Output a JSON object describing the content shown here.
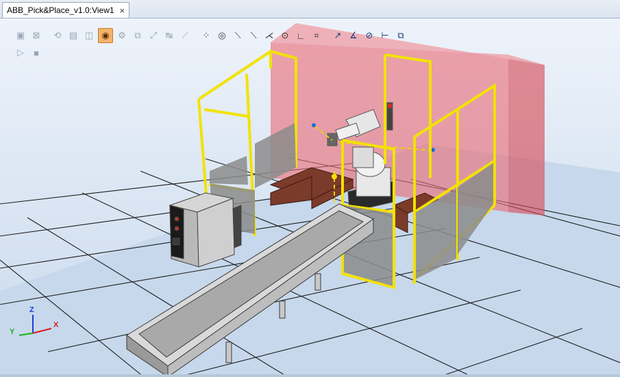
{
  "window": {
    "tab_title": "ABB_Pick&Place_v1.0:View1",
    "tab_close": "×"
  },
  "toolbar": {
    "row1_group1": [
      {
        "name": "view-all-icon",
        "glyph": "▣"
      },
      {
        "name": "view-center-icon",
        "glyph": "⊠"
      }
    ],
    "row1_group2": [
      {
        "name": "select-curve-icon",
        "glyph": "⟲"
      },
      {
        "name": "select-surface-icon",
        "glyph": "▤"
      },
      {
        "name": "select-body-icon",
        "glyph": "◫"
      },
      {
        "name": "select-part-icon",
        "glyph": "◉"
      },
      {
        "name": "select-mechanism-icon",
        "glyph": "⚙"
      },
      {
        "name": "select-group-icon",
        "glyph": "⧉"
      },
      {
        "name": "select-target-icon",
        "glyph": "⤢"
      },
      {
        "name": "select-path-icon",
        "glyph": "↹"
      },
      {
        "name": "select-frame-icon",
        "glyph": "⟋"
      }
    ],
    "row1_group3": [
      {
        "name": "snap-object-icon",
        "glyph": "⁘"
      },
      {
        "name": "snap-center-icon",
        "glyph": "◎"
      },
      {
        "name": "snap-mid-icon",
        "glyph": "⟍"
      },
      {
        "name": "snap-edge-icon",
        "glyph": "⟍"
      },
      {
        "name": "snap-corner-icon",
        "glyph": "⋌"
      },
      {
        "name": "snap-surface-icon",
        "glyph": "⊙"
      },
      {
        "name": "snap-local-icon",
        "glyph": "∟"
      },
      {
        "name": "snap-grid-icon",
        "glyph": "⌗"
      }
    ],
    "row1_group4": [
      {
        "name": "measure-distance-icon",
        "glyph": "↗"
      },
      {
        "name": "measure-angle-icon",
        "glyph": "∡"
      },
      {
        "name": "measure-diameter-icon",
        "glyph": "⊘"
      },
      {
        "name": "measure-minimum-icon",
        "glyph": "⊢"
      },
      {
        "name": "measure-points-icon",
        "glyph": "⧉"
      }
    ],
    "row2": [
      {
        "name": "simulation-play-icon",
        "glyph": "▷"
      },
      {
        "name": "simulation-stop-icon",
        "glyph": "■"
      }
    ]
  },
  "axes": {
    "z": "Z",
    "y": "Y",
    "x": "X"
  },
  "colors": {
    "fence": "#f0e000",
    "safety_zone": "#e8646e",
    "floor": "#c4d6ea",
    "grid": "#1a1a1a",
    "conveyor_belt": "#a8a8a8",
    "pallet": "#7a3a2a"
  }
}
